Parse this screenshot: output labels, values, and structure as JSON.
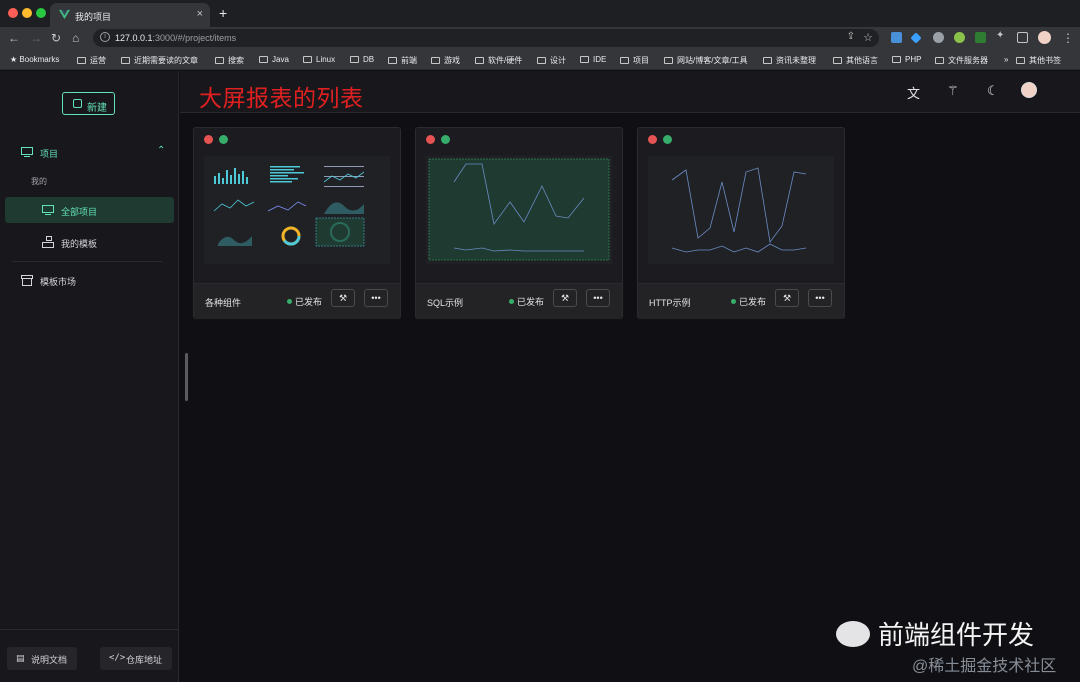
{
  "browser": {
    "tab_title": "我的项目",
    "url_host": "127.0.0.1",
    "url_rest": ":3000/#/project/items",
    "bookmarks": [
      "Bookmarks",
      "运营",
      "近期需要读的文章",
      "搜索",
      "Java",
      "Linux",
      "DB",
      "前端",
      "游戏",
      "软件/硬件",
      "设计",
      "IDE",
      "项目",
      "网站/博客/文章/工具",
      "资讯未整理",
      "其他语言",
      "PHP",
      "文件服务器",
      "»",
      "其他书签"
    ]
  },
  "sidebar": {
    "new_label": "新建",
    "group_label": "项目",
    "sub_label": "我的",
    "items": [
      {
        "label": "全部项目",
        "active": true
      },
      {
        "label": "我的模板",
        "active": false
      }
    ],
    "market_label": "模板市场",
    "docs_label": "说明文档",
    "repo_label": "仓库地址"
  },
  "header": {
    "title": "大屏报表的列表",
    "icons": [
      "translate-icon",
      "magic-wand-icon",
      "moon-icon"
    ]
  },
  "projects": [
    {
      "name": "各种组件",
      "status": "已发布",
      "thumb": "dashboard"
    },
    {
      "name": "SQL示例",
      "status": "已发布",
      "thumb": "sql"
    },
    {
      "name": "HTTP示例",
      "status": "已发布",
      "thumb": "http"
    }
  ],
  "watermark": {
    "brand": "前端组件开发",
    "site": "@稀土掘金技术社区"
  }
}
